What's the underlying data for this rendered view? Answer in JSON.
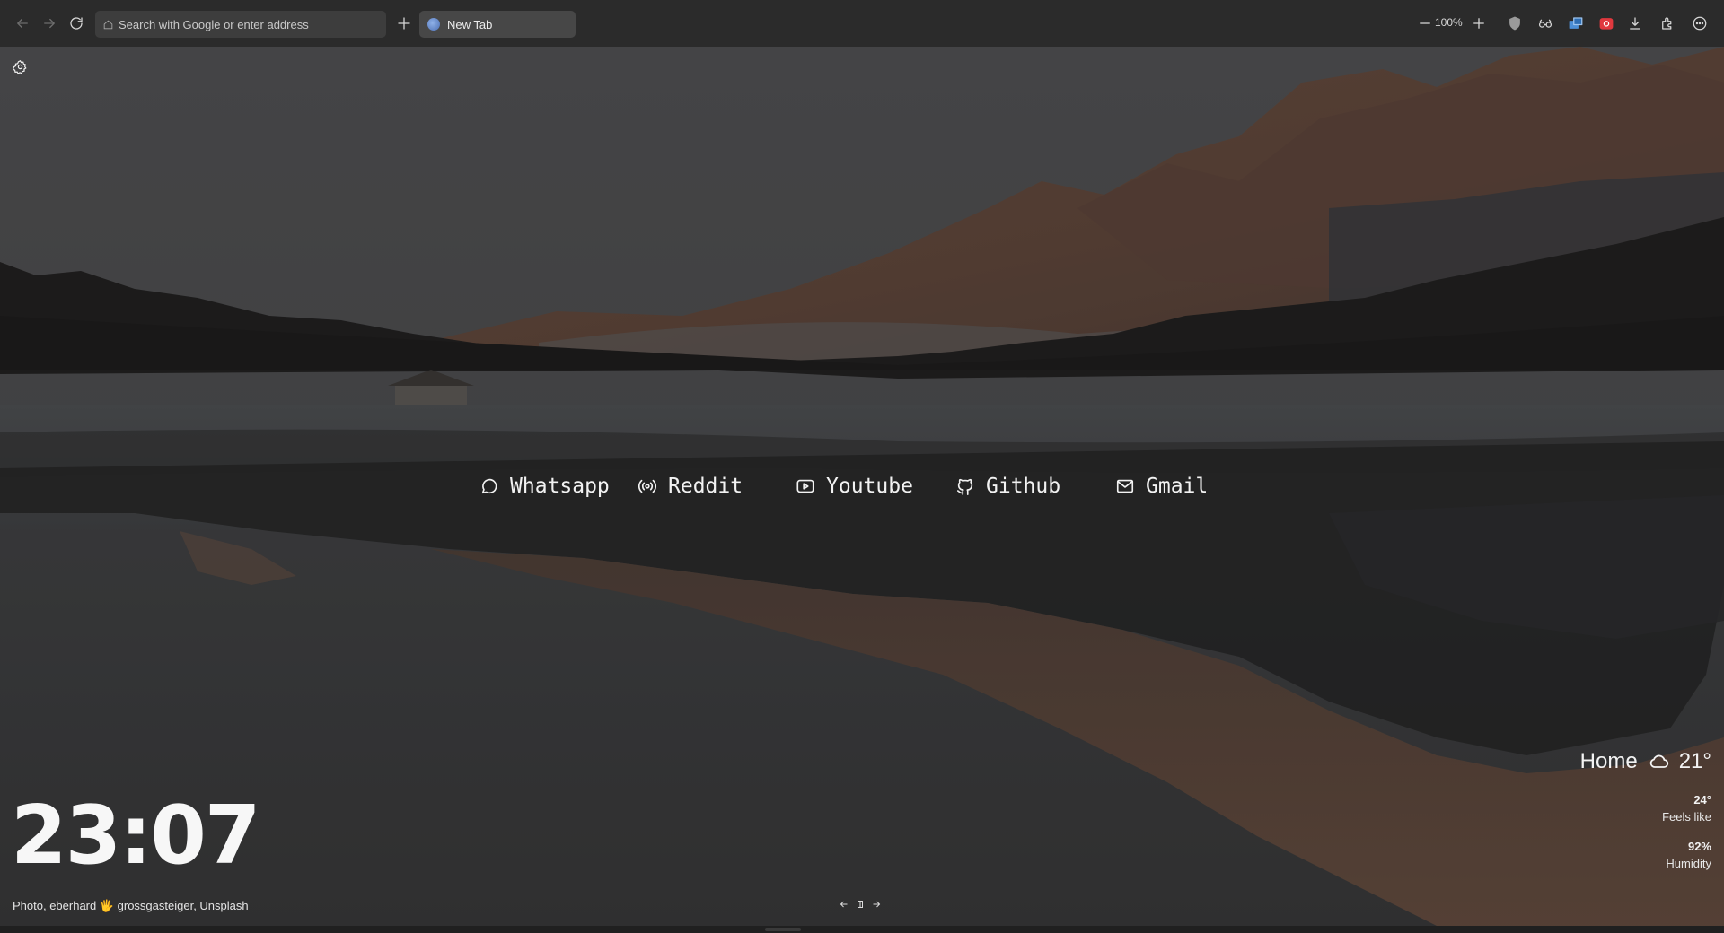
{
  "toolbar": {
    "address_placeholder": "Search with Google or enter address",
    "tab_title": "New Tab",
    "zoom": "100%"
  },
  "links": [
    {
      "label": "Whatsapp",
      "icon": "chat-bubble-icon"
    },
    {
      "label": "Reddit",
      "icon": "broadcast-icon"
    },
    {
      "label": "Youtube",
      "icon": "play-icon"
    },
    {
      "label": "Github",
      "icon": "github-icon"
    },
    {
      "label": "Gmail",
      "icon": "mail-icon"
    }
  ],
  "clock": "23:07",
  "photo_credit": "Photo, eberhard 🖐 grossgasteiger, Unsplash",
  "weather": {
    "location": "Home",
    "icon": "cloud-icon",
    "temperature": "21°",
    "feels_like_value": "24°",
    "feels_like_label": "Feels like",
    "humidity_value": "92%",
    "humidity_label": "Humidity"
  },
  "colors": {
    "toolbar_bg": "#2b2b2b",
    "tab_bg": "#474747",
    "address_bg": "#3d3d3d",
    "text": "#f2f2f2"
  }
}
